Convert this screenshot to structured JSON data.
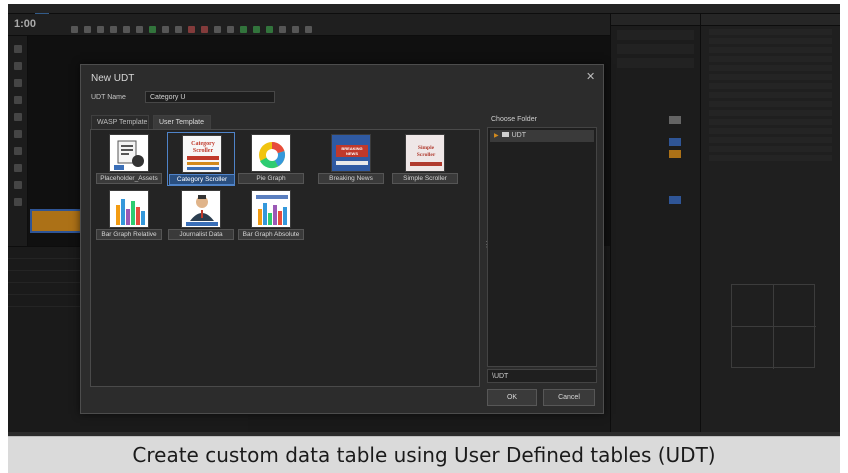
{
  "toolbar": {
    "timecode": "1:00"
  },
  "dialog": {
    "title": "New UDT",
    "close_glyph": "✕",
    "udt_name_label": "UDT Name",
    "udt_name_value": "Category U",
    "tabs": [
      {
        "label": "WASP Template",
        "active": false
      },
      {
        "label": "User Template",
        "active": true
      }
    ],
    "templates": [
      {
        "label": "Placeholder_Assets",
        "icon": "placeholder-assets-thumbnail"
      },
      {
        "label": "Category Scroller",
        "icon": "category-scroller-thumbnail",
        "selected": true,
        "thumb_text": [
          "Category",
          "Scroller"
        ]
      },
      {
        "label": "Pie Graph",
        "icon": "pie-graph-thumbnail"
      },
      {
        "label": "Breaking News",
        "icon": "breaking-news-thumbnail",
        "thumb_text": [
          "BREAKING",
          "NEWS"
        ]
      },
      {
        "label": "Simple Scroller",
        "icon": "simple-scroller-thumbnail",
        "thumb_text": [
          "Simple",
          "Scroller"
        ]
      },
      {
        "label": "Bar Graph Relative",
        "icon": "bar-graph-relative-thumbnail"
      },
      {
        "label": "Journalist Data",
        "icon": "journalist-data-thumbnail"
      },
      {
        "label": "Bar Graph Absolute",
        "icon": "bar-graph-absolute-thumbnail"
      }
    ],
    "choose_folder_label": "Choose Folder",
    "folder": {
      "name": "UDT",
      "icon": "folder-icon",
      "expander_icon": "chevron-right-icon"
    },
    "path_value": "\\UDT",
    "ok_label": "OK",
    "cancel_label": "Cancel"
  },
  "caption": {
    "text": "Create custom data table using User Defined tables (UDT)"
  },
  "colors": {
    "accent_orange": "#d28a1d",
    "selection_blue": "#4f83c8",
    "dialog_bg": "#2c2c2c"
  }
}
